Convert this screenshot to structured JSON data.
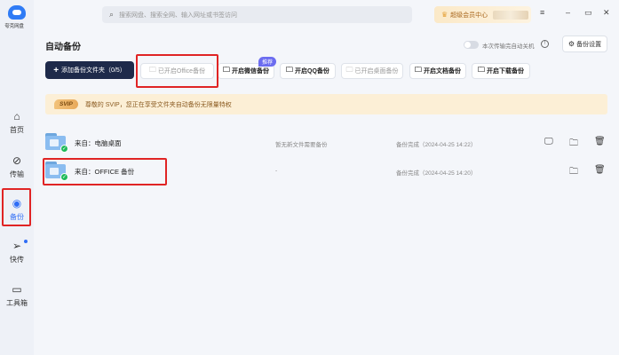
{
  "app": {
    "name": "夸克网盘"
  },
  "search": {
    "placeholder": "搜索网盘、搜索全网、输入网址或书签访问"
  },
  "vip": {
    "label": "超级会员中心"
  },
  "window": {
    "minimize": "–",
    "restore": "▭",
    "close": "✕",
    "menu": "≡"
  },
  "nav": [
    {
      "label": "首页",
      "icon": "home-icon"
    },
    {
      "label": "传输",
      "icon": "transfer-icon"
    },
    {
      "label": "备份",
      "icon": "backup-icon",
      "active": true
    },
    {
      "label": "快传",
      "icon": "send-icon"
    },
    {
      "label": "工具箱",
      "icon": "toolbox-icon"
    }
  ],
  "page": {
    "title": "自动备份",
    "toggle_label": "本次传输完自动关机",
    "settings_label": "备份设置"
  },
  "actions": {
    "add_folder": "添加备份文件夹（0/5）",
    "recommend_badge": "推荐",
    "buttons": [
      {
        "label": "已开启Office备份",
        "disabled": true
      },
      {
        "label": "开启微信备份",
        "disabled": false
      },
      {
        "label": "开启QQ备份",
        "disabled": false
      },
      {
        "label": "已开启桌面备份",
        "disabled": true
      },
      {
        "label": "开启文档备份",
        "disabled": false
      },
      {
        "label": "开启下载备份",
        "disabled": false
      }
    ]
  },
  "svip": {
    "tag": "SVIP",
    "text": "尊敬的 SVIP，您正在享受文件夹自动备份无限量特权"
  },
  "rows": [
    {
      "name": "来自：电脑桌面",
      "status": "暂无新文件需要备份",
      "time": "备份完成（2024-04-25 14:22）"
    },
    {
      "name": "来自：OFFICE 备份",
      "status": "-",
      "time": "备份完成（2024-04-25 14:20）"
    }
  ]
}
